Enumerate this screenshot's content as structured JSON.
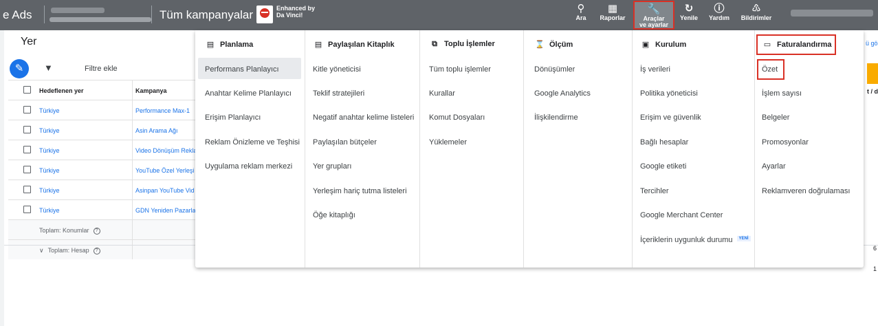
{
  "topbar": {
    "app_name": "e Ads",
    "crumb": "Tüm kampanyalar",
    "badge_line1": "Enhanced by",
    "badge_line2": "Da Vinci!",
    "tools": [
      {
        "icon": "search-icon",
        "label": "Ara"
      },
      {
        "icon": "reports-icon",
        "label": "Raporlar"
      },
      {
        "icon": "wrench-icon",
        "label": "Araçlar",
        "label2": "ve ayarlar"
      },
      {
        "icon": "refresh-icon",
        "label": "Yenile"
      },
      {
        "icon": "help-icon",
        "label": "Yardım"
      },
      {
        "icon": "bell-icon",
        "label": "Bildirimler"
      }
    ]
  },
  "page": {
    "title": "Yer",
    "filter_label": "Filtre ekle",
    "table": {
      "headers": [
        "Hedeflenen yer",
        "Kampanya"
      ],
      "rows": [
        [
          "Türkiye",
          "Performance Max-1"
        ],
        [
          "Türkiye",
          "Asin Arama Ağı"
        ],
        [
          "Türkiye",
          "Video Dönüşüm Rekla"
        ],
        [
          "Türkiye",
          "YouTube Özel Yerleşi"
        ],
        [
          "Türkiye",
          "Asinpan YouTube Vid"
        ],
        [
          "Türkiye",
          "GDN Yeniden Pazarla"
        ]
      ],
      "total_locations": "Toplam: Konumlar",
      "total_account": "Toplam: Hesap"
    },
    "right_peek_top": "ü gö",
    "right_peek_col": "t / d",
    "right_peek_num1": "6",
    "right_peek_num2": "1"
  },
  "menu": {
    "columns": [
      {
        "icon": "calendar-icon",
        "title": "Planlama",
        "items": [
          "Performans Planlayıcı",
          "Anahtar Kelime Planlayıcı",
          "Erişim Planlayıcı",
          "Reklam Önizleme ve Teşhisi",
          "Uygulama reklam merkezi"
        ]
      },
      {
        "icon": "library-icon",
        "title": "Paylaşılan Kitaplık",
        "items": [
          "Kitle yöneticisi",
          "Teklif stratejileri",
          "Negatif anahtar kelime listeleri",
          "Paylaşılan bütçeler",
          "Yer grupları",
          "Yerleşim hariç tutma listeleri",
          "Öğe kitaplığı"
        ]
      },
      {
        "icon": "bulk-icon",
        "title": "Toplu İşlemler",
        "items": [
          "Tüm toplu işlemler",
          "Kurallar",
          "Komut Dosyaları",
          "Yüklemeler"
        ]
      },
      {
        "icon": "hourglass-icon",
        "title": "Ölçüm",
        "items": [
          "Dönüşümler",
          "Google Analytics",
          "İlişkilendirme"
        ]
      },
      {
        "icon": "setup-icon",
        "title": "Kurulum",
        "items": [
          "İş verileri",
          "Politika yöneticisi",
          "Erişim ve güvenlik",
          "Bağlı hesaplar",
          "Google etiketi",
          "Tercihler",
          "Google Merchant Center",
          "İçeriklerin uygunluk durumu"
        ],
        "new_badge": "YENİ"
      },
      {
        "icon": "card-icon",
        "title": "Faturalandırma",
        "items": [
          "Özet",
          "İşlem sayısı",
          "Belgeler",
          "Promosyonlar",
          "Ayarlar",
          "Reklamveren doğrulaması"
        ]
      }
    ]
  }
}
